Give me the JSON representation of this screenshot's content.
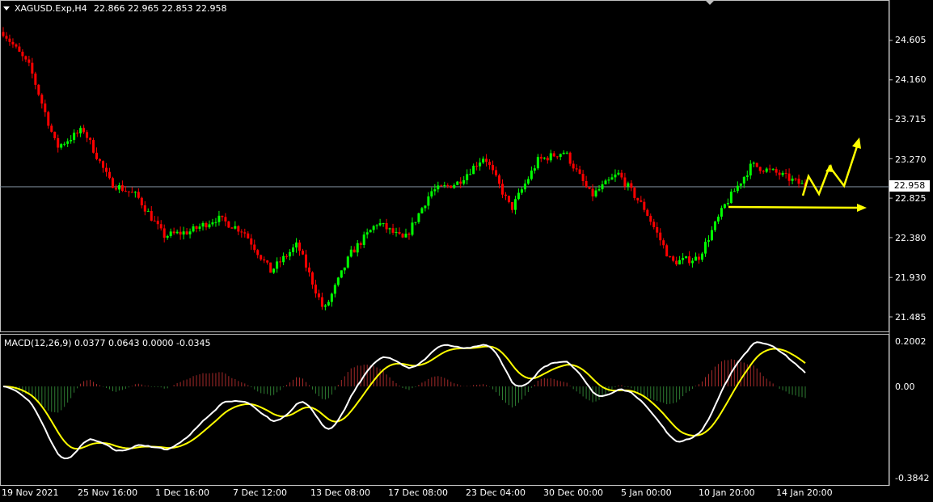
{
  "header": {
    "symbol": "XAGUSD.Exp,H4",
    "ohlc": "22.866 22.965 22.853 22.958"
  },
  "price_axis": {
    "ticks": [
      "24.605",
      "24.160",
      "23.715",
      "23.270",
      "22.825",
      "22.380",
      "21.930",
      "21.485"
    ],
    "current_price": "22.958"
  },
  "macd": {
    "label": "MACD(12,26,9) 0.0377 0.0643 0.0000 -0.0345",
    "ticks": [
      "0.2002",
      "0.00",
      "-0.3842"
    ]
  },
  "time_axis": {
    "labels": [
      "19 Nov 2021",
      "25 Nov 16:00",
      "1 Dec 16:00",
      "7 Dec 12:00",
      "13 Dec 08:00",
      "17 Dec 08:00",
      "23 Dec 04:00",
      "30 Dec 00:00",
      "5 Jan 00:00",
      "10 Jan 20:00",
      "14 Jan 20:00"
    ]
  },
  "colors": {
    "background": "#000000",
    "bull": "#00ff00",
    "bear": "#ff0000",
    "macd_line": "#ffffff",
    "signal_line": "#ffff00",
    "hist_pos": "#a52a2a",
    "hist_neg": "#2e7d32",
    "annotation": "#ffff00"
  },
  "chart_data": {
    "type": "candlestick",
    "symbol": "XAGUSD.Exp",
    "timeframe": "H4",
    "ylim": [
      21.43,
      24.84
    ],
    "price_key_points": [
      [
        "19 Nov 2021",
        24.7
      ],
      [
        "22 Nov",
        24.3
      ],
      [
        "23 Nov",
        23.4
      ],
      [
        "25 Nov 16:00",
        23.6
      ],
      [
        "26 Nov",
        23.0
      ],
      [
        "30 Nov",
        22.85
      ],
      [
        "1 Dec 16:00",
        22.4
      ],
      [
        "3 Dec",
        22.45
      ],
      [
        "7 Dec 12:00",
        22.6
      ],
      [
        "9 Dec",
        22.45
      ],
      [
        "10 Dec",
        22.0
      ],
      [
        "13 Dec 08:00",
        22.3
      ],
      [
        "15 Dec",
        21.55
      ],
      [
        "16 Dec",
        22.2
      ],
      [
        "17 Dec 08:00",
        22.55
      ],
      [
        "20 Dec",
        22.35
      ],
      [
        "22 Dec",
        22.9
      ],
      [
        "23 Dec 04:00",
        23.0
      ],
      [
        "24 Dec",
        23.3
      ],
      [
        "28 Dec",
        22.7
      ],
      [
        "30 Dec 00:00",
        23.25
      ],
      [
        "31 Dec",
        23.35
      ],
      [
        "3 Jan",
        22.85
      ],
      [
        "4 Jan",
        23.1
      ],
      [
        "5 Jan 00:00",
        22.7
      ],
      [
        "6 Jan",
        22.1
      ],
      [
        "7 Jan",
        22.15
      ],
      [
        "10 Jan 20:00",
        22.75
      ],
      [
        "11 Jan",
        23.2
      ],
      [
        "13 Jan",
        23.1
      ],
      [
        "14 Jan 20:00",
        22.958
      ]
    ],
    "macd_ylim": [
      -0.3842,
      0.2002
    ],
    "annotations": [
      "horizontal arrow at 22.76",
      "zigzag arrow projecting upward"
    ]
  }
}
